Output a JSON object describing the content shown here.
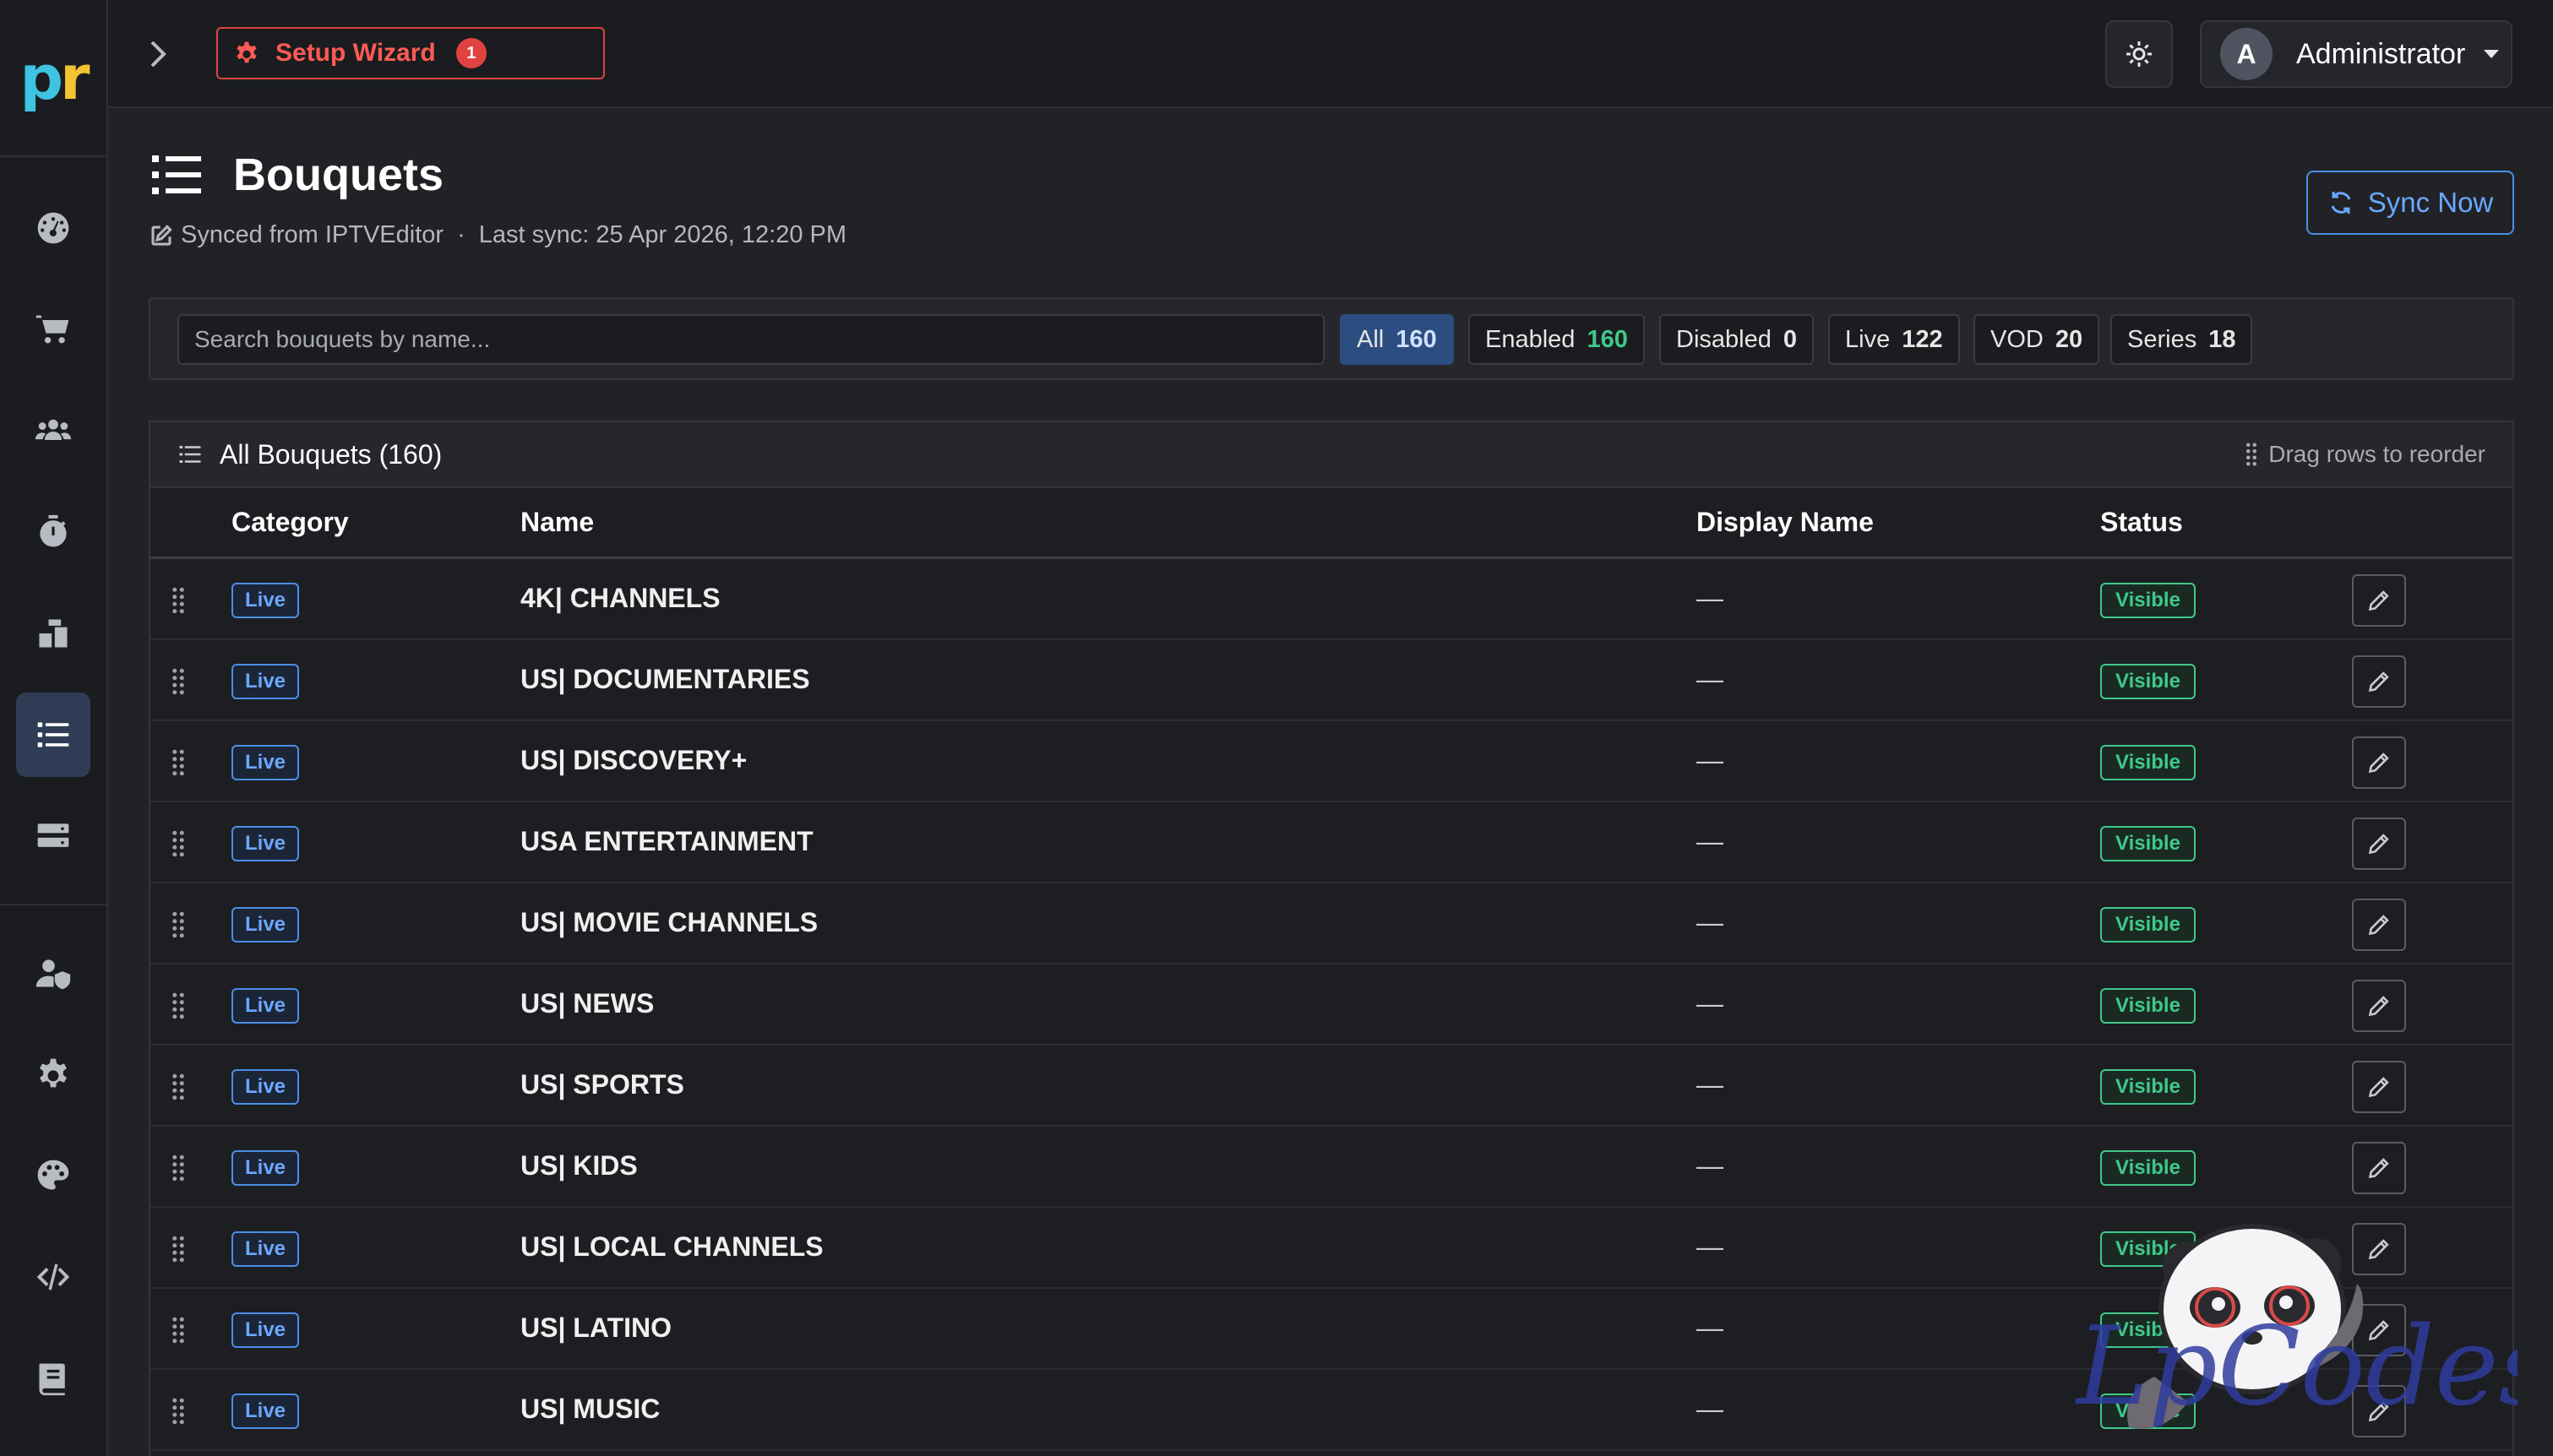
{
  "brand": {
    "logo_p": "p",
    "logo_r": "r"
  },
  "sidebar": {
    "items": [
      {
        "name": "dashboard",
        "icon": "gauge-icon"
      },
      {
        "name": "orders",
        "icon": "cart-icon"
      },
      {
        "name": "users",
        "icon": "users-icon"
      },
      {
        "name": "timers",
        "icon": "stopwatch-icon"
      },
      {
        "name": "packages",
        "icon": "boxes-icon"
      },
      {
        "name": "bouquets",
        "icon": "list-icon",
        "active": true
      },
      {
        "name": "servers",
        "icon": "server-icon"
      },
      {
        "name": "admins",
        "icon": "user-shield-icon"
      },
      {
        "name": "settings",
        "icon": "gear-icon"
      },
      {
        "name": "theme",
        "icon": "palette-icon"
      },
      {
        "name": "developer",
        "icon": "code-icon"
      },
      {
        "name": "logs",
        "icon": "book-icon"
      }
    ]
  },
  "topbar": {
    "wizard_label": "Setup Wizard",
    "wizard_badge": "1",
    "user_initial": "A",
    "user_name": "Administrator"
  },
  "page": {
    "title": "Bouquets",
    "synced_from": "Synced from IPTVEditor",
    "separator": "·",
    "last_sync": "Last sync: 25 Apr 2026, 12:20 PM",
    "sync_button": "Sync Now"
  },
  "filters": {
    "search_placeholder": "Search bouquets by name...",
    "chips": [
      {
        "label": "All",
        "count": "160"
      },
      {
        "label": "Enabled",
        "count": "160"
      },
      {
        "label": "Disabled",
        "count": "0"
      },
      {
        "label": "Live",
        "count": "122"
      },
      {
        "label": "VOD",
        "count": "20"
      },
      {
        "label": "Series",
        "count": "18"
      }
    ]
  },
  "table": {
    "title": "All Bouquets (160)",
    "drag_hint": "Drag rows to reorder",
    "columns": [
      "Category",
      "Name",
      "Display Name",
      "Status"
    ],
    "rows": [
      {
        "category": "Live",
        "name": "4K| CHANNELS",
        "display": "—",
        "status": "Visible"
      },
      {
        "category": "Live",
        "name": "US| DOCUMENTARIES",
        "display": "—",
        "status": "Visible"
      },
      {
        "category": "Live",
        "name": "US| DISCOVERY+",
        "display": "—",
        "status": "Visible"
      },
      {
        "category": "Live",
        "name": "USA ENTERTAINMENT",
        "display": "—",
        "status": "Visible"
      },
      {
        "category": "Live",
        "name": "US| MOVIE CHANNELS",
        "display": "—",
        "status": "Visible"
      },
      {
        "category": "Live",
        "name": "US| NEWS",
        "display": "—",
        "status": "Visible"
      },
      {
        "category": "Live",
        "name": "US| SPORTS",
        "display": "—",
        "status": "Visible"
      },
      {
        "category": "Live",
        "name": "US| KIDS",
        "display": "—",
        "status": "Visible"
      },
      {
        "category": "Live",
        "name": "US| LOCAL CHANNELS",
        "display": "—",
        "status": "Visible"
      },
      {
        "category": "Live",
        "name": "US| LATINO",
        "display": "—",
        "status": "Visible"
      },
      {
        "category": "Live",
        "name": "US| MUSIC",
        "display": "—",
        "status": "Visible"
      }
    ]
  },
  "watermark": {
    "text": "LpCodes"
  }
}
